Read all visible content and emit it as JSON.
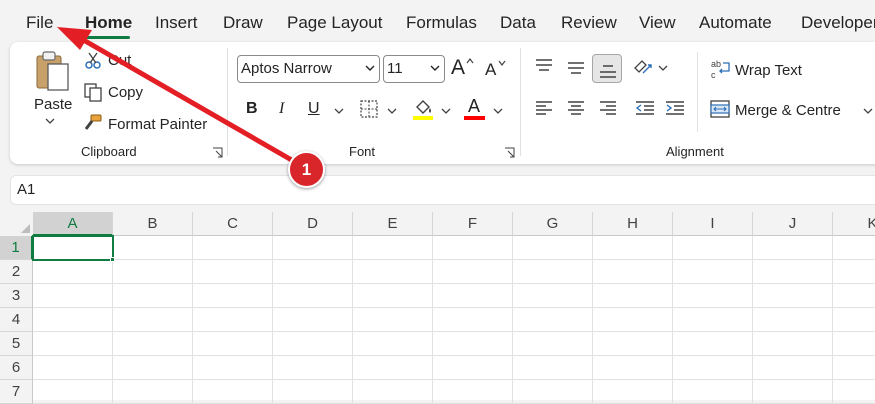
{
  "tabs": [
    "File",
    "Home",
    "Insert",
    "Draw",
    "Page Layout",
    "Formulas",
    "Data",
    "Review",
    "View",
    "Automate",
    "Developer"
  ],
  "active_tab": "Home",
  "clipboard": {
    "paste_label": "Paste",
    "cut_label": "Cut",
    "copy_label": "Copy",
    "format_painter_label": "Format Painter",
    "group_label": "Clipboard"
  },
  "font": {
    "name": "Aptos Narrow",
    "size": "11",
    "bold": "B",
    "italic": "I",
    "underline": "U",
    "font_color_letter": "A",
    "grow_letter": "A",
    "shrink_letter": "A",
    "group_label": "Font"
  },
  "alignment": {
    "wrap_text_label": "Wrap Text",
    "merge_label": "Merge & Centre",
    "group_label": "Alignment"
  },
  "namebox": {
    "value": "A1"
  },
  "grid": {
    "columns": [
      "A",
      "B",
      "C",
      "D",
      "E",
      "F",
      "G",
      "H",
      "I",
      "J",
      "K"
    ],
    "rows": [
      "1",
      "2",
      "3",
      "4",
      "5",
      "6",
      "7"
    ],
    "selected_cell": "A1"
  },
  "annotation": {
    "label": "1"
  },
  "colors": {
    "accent": "#107c41",
    "highlight": "#ffff00",
    "font_color": "#ff0000",
    "annotation": "#d9262b"
  }
}
